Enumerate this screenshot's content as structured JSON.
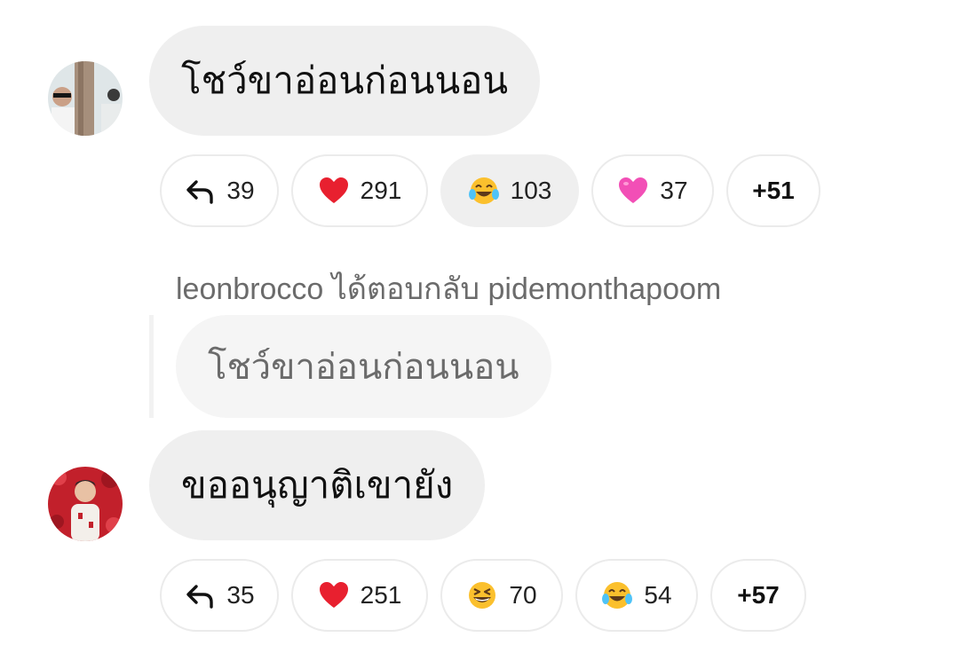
{
  "comments": [
    {
      "text": "โชว์ขาอ่อนก่อนนอน",
      "reactions": [
        {
          "icon": "reply-arrow-icon",
          "count": "39"
        },
        {
          "icon": "red-heart-icon",
          "count": "291"
        },
        {
          "icon": "tears-of-joy-icon",
          "count": "103",
          "selected": true
        },
        {
          "icon": "pink-heart-icon",
          "count": "37"
        }
      ],
      "more": "+51"
    },
    {
      "text": "ขออนุญาติเขายัง",
      "reactions": [
        {
          "icon": "reply-arrow-icon",
          "count": "35"
        },
        {
          "icon": "red-heart-icon",
          "count": "251"
        },
        {
          "icon": "grinning-squint-icon",
          "count": "70"
        },
        {
          "icon": "tears-of-joy-icon",
          "count": "54"
        }
      ],
      "more": "+57"
    }
  ],
  "reply": {
    "header": "leonbrocco ได้ตอบกลับ pidemonthapoom",
    "quoted_text": "โชว์ขาอ่อนก่อนนอน"
  },
  "colors": {
    "bubble": "#efefef",
    "pill_border": "#ebebeb",
    "muted_text": "#6b6b6b",
    "heart_red": "#e8202f",
    "heart_pink": "#f24fb6",
    "emoji_yellow": "#fbc02d"
  }
}
